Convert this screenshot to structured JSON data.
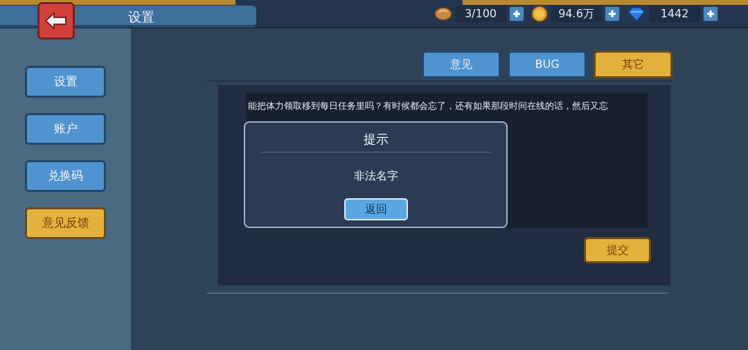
{
  "header": {
    "title": "设置"
  },
  "resources": [
    {
      "kind": "bread",
      "value": "3/100"
    },
    {
      "kind": "coin",
      "value": "94.6万"
    },
    {
      "kind": "gem",
      "value": "1442"
    }
  ],
  "sidebar": {
    "items": [
      {
        "label": "设置",
        "selected": false
      },
      {
        "label": "账户",
        "selected": false
      },
      {
        "label": "兑换码",
        "selected": false
      },
      {
        "label": "意见反馈",
        "selected": true
      }
    ]
  },
  "tabs": [
    {
      "label": "意见",
      "selected": false
    },
    {
      "label": "BUG",
      "selected": false
    },
    {
      "label": "其它",
      "selected": true
    }
  ],
  "feedback": {
    "value": "能把体力领取移到每日任务里吗？有时候都会忘了，还有如果那段时间在线的话，然后又忘",
    "submit": "提交"
  },
  "dialog": {
    "title": "提示",
    "message": "非法名字",
    "button": "返回"
  }
}
